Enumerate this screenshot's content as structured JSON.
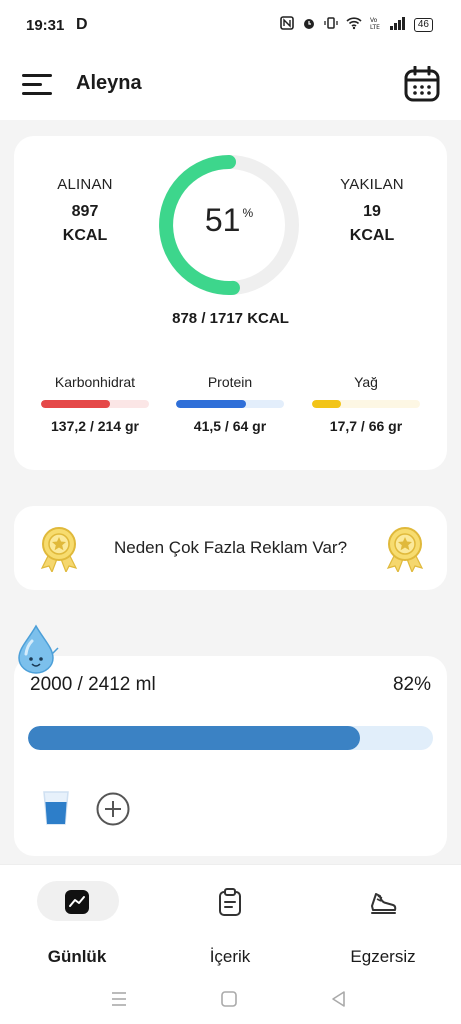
{
  "status_bar": {
    "time": "19:31",
    "app_letter": "D",
    "battery": "46"
  },
  "header": {
    "user_name": "Aleyna"
  },
  "calories": {
    "taken_label": "ALINAN",
    "taken_value": "897",
    "taken_unit": "KCAL",
    "burned_label": "YAKILAN",
    "burned_value": "19",
    "burned_unit": "KCAL",
    "percent": "51",
    "percent_symbol": "%",
    "percent_value": 51,
    "total": "878 / 1717 KCAL",
    "accent_color": "#3dd68c"
  },
  "macros": [
    {
      "name": "Karbonhidrat",
      "value": "137,2 / 214 gr",
      "fraction": 0.64,
      "color": "#e54848",
      "track": "#fbe6e6"
    },
    {
      "name": "Protein",
      "value": "41,5 / 64 gr",
      "fraction": 0.65,
      "color": "#2f6fd8",
      "track": "#e3eefb"
    },
    {
      "name": "Yağ",
      "value": "17,7 / 66 gr",
      "fraction": 0.27,
      "color": "#f2c418",
      "track": "#fdf7e4"
    }
  ],
  "ad_banner": {
    "text": "Neden Çok Fazla Reklam Var?"
  },
  "water": {
    "amount": "2000 / 2412 ml",
    "percent": "82%",
    "fraction": 0.82,
    "color": "#3b82c4"
  },
  "nav": {
    "daily": "Günlük",
    "content": "İçerik",
    "exercise": "Egzersiz"
  }
}
